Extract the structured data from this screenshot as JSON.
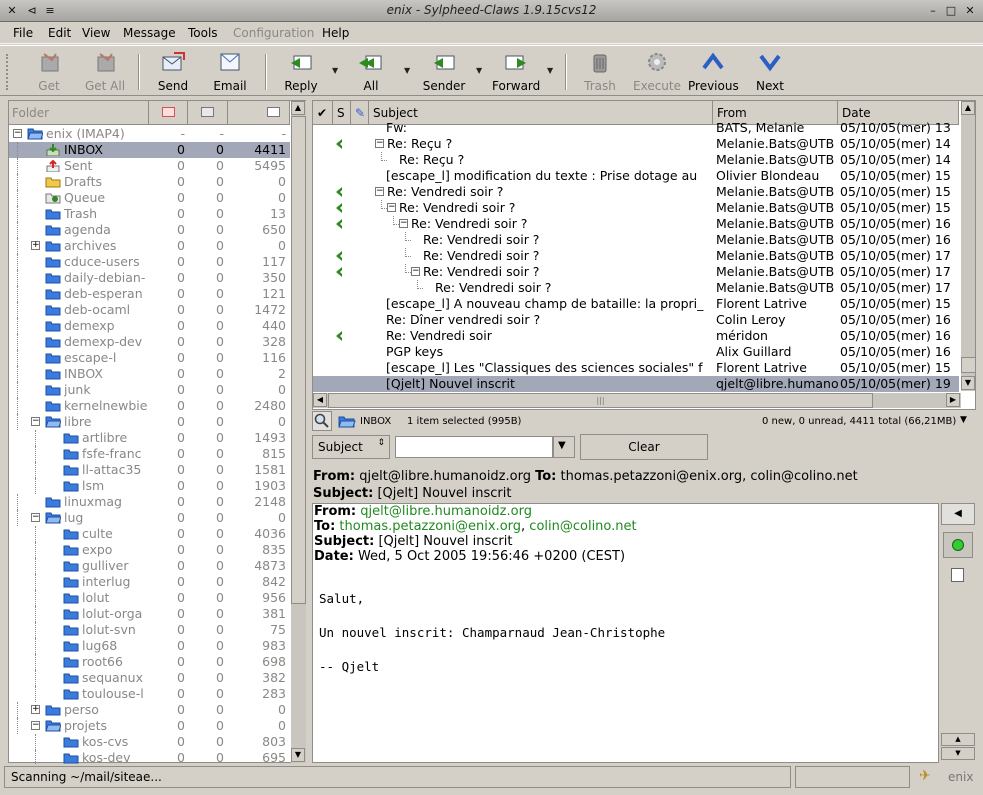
{
  "window": {
    "title": "enix - Sylpheed-Claws 1.9.15cvs12"
  },
  "menu": [
    {
      "label": "File",
      "disabled": false
    },
    {
      "label": "Edit",
      "disabled": false
    },
    {
      "label": "View",
      "disabled": false
    },
    {
      "label": "Message",
      "disabled": false
    },
    {
      "label": "Tools",
      "disabled": false
    },
    {
      "label": "Configuration",
      "disabled": true
    },
    {
      "label": "Help",
      "disabled": false
    }
  ],
  "toolbar": {
    "get": "Get",
    "get_all": "Get All",
    "send": "Send",
    "email": "Email",
    "reply": "Reply",
    "all": "All",
    "sender": "Sender",
    "forward": "Forward",
    "trash": "Trash",
    "execute": "Execute",
    "previous": "Previous",
    "next": "Next"
  },
  "folder_pane": {
    "header": "Folder",
    "folders": [
      {
        "name": "enix (IMAP4)",
        "new": "-",
        "unread": "-",
        "total": "-",
        "depth": 0,
        "icon": "folder-open-icon",
        "expander": "-"
      },
      {
        "name": "INBOX",
        "new": "0",
        "unread": "0",
        "total": "4411",
        "depth": 1,
        "icon": "inbox-icon",
        "selected": true
      },
      {
        "name": "Sent",
        "new": "0",
        "unread": "0",
        "total": "5495",
        "depth": 1,
        "icon": "outbox-icon"
      },
      {
        "name": "Drafts",
        "new": "0",
        "unread": "0",
        "total": "0",
        "depth": 1,
        "icon": "drafts-folder-icon"
      },
      {
        "name": "Queue",
        "new": "0",
        "unread": "0",
        "total": "0",
        "depth": 1,
        "icon": "queue-icon"
      },
      {
        "name": "Trash",
        "new": "0",
        "unread": "0",
        "total": "13",
        "depth": 1,
        "icon": "trash-icon"
      },
      {
        "name": "agenda",
        "new": "0",
        "unread": "0",
        "total": "650",
        "depth": 1,
        "icon": "folder-icon"
      },
      {
        "name": "archives",
        "new": "0",
        "unread": "0",
        "total": "0",
        "depth": 1,
        "icon": "folder-icon",
        "expander": "+"
      },
      {
        "name": "cduce-users",
        "new": "0",
        "unread": "0",
        "total": "117",
        "depth": 1,
        "icon": "folder-icon"
      },
      {
        "name": "daily-debian-",
        "new": "0",
        "unread": "0",
        "total": "350",
        "depth": 1,
        "icon": "folder-icon"
      },
      {
        "name": "deb-esperan",
        "new": "0",
        "unread": "0",
        "total": "121",
        "depth": 1,
        "icon": "folder-icon"
      },
      {
        "name": "deb-ocaml",
        "new": "0",
        "unread": "0",
        "total": "1472",
        "depth": 1,
        "icon": "folder-icon"
      },
      {
        "name": "demexp",
        "new": "0",
        "unread": "0",
        "total": "440",
        "depth": 1,
        "icon": "folder-icon"
      },
      {
        "name": "demexp-dev",
        "new": "0",
        "unread": "0",
        "total": "328",
        "depth": 1,
        "icon": "folder-icon"
      },
      {
        "name": "escape-l",
        "new": "0",
        "unread": "0",
        "total": "116",
        "depth": 1,
        "icon": "folder-icon"
      },
      {
        "name": "INBOX",
        "new": "0",
        "unread": "0",
        "total": "2",
        "depth": 1,
        "icon": "folder-icon"
      },
      {
        "name": "junk",
        "new": "0",
        "unread": "0",
        "total": "0",
        "depth": 1,
        "icon": "folder-icon"
      },
      {
        "name": "kernelnewbie",
        "new": "0",
        "unread": "0",
        "total": "2480",
        "depth": 1,
        "icon": "folder-icon"
      },
      {
        "name": "libre",
        "new": "0",
        "unread": "0",
        "total": "0",
        "depth": 1,
        "icon": "folder-open-icon",
        "expander": "-"
      },
      {
        "name": "artlibre",
        "new": "0",
        "unread": "0",
        "total": "1493",
        "depth": 2,
        "icon": "folder-icon"
      },
      {
        "name": "fsfe-franc",
        "new": "0",
        "unread": "0",
        "total": "815",
        "depth": 2,
        "icon": "folder-icon"
      },
      {
        "name": "ll-attac35",
        "new": "0",
        "unread": "0",
        "total": "1581",
        "depth": 2,
        "icon": "folder-icon"
      },
      {
        "name": "lsm",
        "new": "0",
        "unread": "0",
        "total": "1903",
        "depth": 2,
        "icon": "folder-icon"
      },
      {
        "name": "linuxmag",
        "new": "0",
        "unread": "0",
        "total": "2148",
        "depth": 1,
        "icon": "folder-icon"
      },
      {
        "name": "lug",
        "new": "0",
        "unread": "0",
        "total": "0",
        "depth": 1,
        "icon": "folder-open-icon",
        "expander": "-"
      },
      {
        "name": "culte",
        "new": "0",
        "unread": "0",
        "total": "4036",
        "depth": 2,
        "icon": "folder-icon"
      },
      {
        "name": "expo",
        "new": "0",
        "unread": "0",
        "total": "835",
        "depth": 2,
        "icon": "folder-icon"
      },
      {
        "name": "gulliver",
        "new": "0",
        "unread": "0",
        "total": "4873",
        "depth": 2,
        "icon": "folder-icon"
      },
      {
        "name": "interlug",
        "new": "0",
        "unread": "0",
        "total": "842",
        "depth": 2,
        "icon": "folder-icon"
      },
      {
        "name": "lolut",
        "new": "0",
        "unread": "0",
        "total": "956",
        "depth": 2,
        "icon": "folder-icon"
      },
      {
        "name": "lolut-orga",
        "new": "0",
        "unread": "0",
        "total": "381",
        "depth": 2,
        "icon": "folder-icon"
      },
      {
        "name": "lolut-svn",
        "new": "0",
        "unread": "0",
        "total": "75",
        "depth": 2,
        "icon": "folder-icon"
      },
      {
        "name": "lug68",
        "new": "0",
        "unread": "0",
        "total": "983",
        "depth": 2,
        "icon": "folder-icon"
      },
      {
        "name": "root66",
        "new": "0",
        "unread": "0",
        "total": "698",
        "depth": 2,
        "icon": "folder-icon"
      },
      {
        "name": "sequanux",
        "new": "0",
        "unread": "0",
        "total": "382",
        "depth": 2,
        "icon": "folder-icon"
      },
      {
        "name": "toulouse-l",
        "new": "0",
        "unread": "0",
        "total": "283",
        "depth": 2,
        "icon": "folder-icon"
      },
      {
        "name": "perso",
        "new": "0",
        "unread": "0",
        "total": "0",
        "depth": 1,
        "icon": "folder-icon",
        "expander": "+"
      },
      {
        "name": "projets",
        "new": "0",
        "unread": "0",
        "total": "0",
        "depth": 1,
        "icon": "folder-open-icon",
        "expander": "-"
      },
      {
        "name": "kos-cvs",
        "new": "0",
        "unread": "0",
        "total": "803",
        "depth": 2,
        "icon": "folder-icon"
      },
      {
        "name": "kos-dev",
        "new": "0",
        "unread": "0",
        "total": "695",
        "depth": 2,
        "icon": "folder-icon"
      }
    ]
  },
  "message_list": {
    "columns": {
      "subject": "Subject",
      "from": "From",
      "date": "Date"
    },
    "rows": [
      {
        "subject": "Fw:",
        "from": "BATS, Melanie",
        "date": "05/10/05(mer) 13",
        "indent": 0,
        "replied": false
      },
      {
        "subject": "Re: Reçu ?",
        "from": "Melanie.Bats@UTB",
        "date": "05/10/05(mer) 14",
        "indent": 0,
        "replied": true,
        "expander": "-"
      },
      {
        "subject": "Re: Reçu ?",
        "from": "Melanie.Bats@UTB",
        "date": "05/10/05(mer) 14",
        "indent": 1,
        "replied": false
      },
      {
        "subject": "[escape_l] modification du texte : Prise dotage au",
        "from": "Olivier Blondeau",
        "date": "05/10/05(mer) 15",
        "indent": 0,
        "replied": false
      },
      {
        "subject": "Re: Vendredi soir ?",
        "from": "Melanie.Bats@UTB",
        "date": "05/10/05(mer) 15",
        "indent": 0,
        "replied": true,
        "expander": "-"
      },
      {
        "subject": "Re: Vendredi soir ?",
        "from": "Melanie.Bats@UTB",
        "date": "05/10/05(mer) 15",
        "indent": 1,
        "replied": true,
        "expander": "-"
      },
      {
        "subject": "Re: Vendredi soir ?",
        "from": "Melanie.Bats@UTB",
        "date": "05/10/05(mer) 16",
        "indent": 2,
        "replied": true,
        "expander": "-"
      },
      {
        "subject": "Re: Vendredi soir ?",
        "from": "Melanie.Bats@UTB",
        "date": "05/10/05(mer) 16",
        "indent": 3,
        "replied": false
      },
      {
        "subject": "Re: Vendredi soir ?",
        "from": "Melanie.Bats@UTB",
        "date": "05/10/05(mer) 17",
        "indent": 3,
        "replied": true
      },
      {
        "subject": "Re: Vendredi soir ?",
        "from": "Melanie.Bats@UTB",
        "date": "05/10/05(mer) 17",
        "indent": 3,
        "replied": true,
        "expander": "-"
      },
      {
        "subject": "Re: Vendredi soir ?",
        "from": "Melanie.Bats@UTB",
        "date": "05/10/05(mer) 17",
        "indent": 4,
        "replied": false
      },
      {
        "subject": "[escape_l] A nouveau champ de bataille: la propri_",
        "from": "Florent Latrive",
        "date": "05/10/05(mer) 15",
        "indent": 0,
        "replied": false
      },
      {
        "subject": "Re: Dîner vendredi soir ?",
        "from": "Colin Leroy",
        "date": "05/10/05(mer) 16",
        "indent": 0,
        "replied": false
      },
      {
        "subject": "Re: Vendredi soir",
        "from": "méridon",
        "date": "05/10/05(mer) 16",
        "indent": 0,
        "replied": true
      },
      {
        "subject": "PGP keys",
        "from": "Alix Guillard",
        "date": "05/10/05(mer) 16",
        "indent": 0,
        "replied": false
      },
      {
        "subject": "[escape_l] Les \"Classiques des sciences sociales\" f",
        "from": "Florent Latrive",
        "date": "05/10/05(mer) 15",
        "indent": 0,
        "replied": false
      },
      {
        "subject": "[Qjelt] Nouvel inscrit",
        "from": "qjelt@libre.humanoidz.org",
        "date": "05/10/05(mer) 19",
        "indent": 0,
        "replied": false,
        "selected": true
      }
    ]
  },
  "info_bar": {
    "folder": "INBOX",
    "selection": "1 item selected (995B)",
    "counts": "0 new, 0 unread, 4411 total (66,21MB)"
  },
  "search": {
    "field": "Subject",
    "value": "",
    "clear": "Clear"
  },
  "summary_header": {
    "from_label": "From:",
    "from": "qjelt@libre.humanoidz.org",
    "to_label": "To:",
    "to": "thomas.petazzoni@enix.org, colin@colino.net",
    "subject_label": "Subject:",
    "subject": "[Qjelt] Nouvel inscrit"
  },
  "message": {
    "from_label": "From:",
    "from": "qjelt@libre.humanoidz.org",
    "to_label": "To:",
    "to_1": "thomas.petazzoni@enix.org",
    "to_sep": ",",
    "to_2": "colin@colino.net",
    "subject_label": "Subject:",
    "subject": "[Qjelt] Nouvel inscrit",
    "date_label": "Date:",
    "date": "Wed,  5 Oct 2005 19:56:46 +0200 (CEST)",
    "body_1": "Salut,",
    "body_2": "Un nouvel inscrit: Champarnaud Jean-Christophe",
    "body_3": "-- Qjelt"
  },
  "statusbar": {
    "text": "Scanning ~/mail/siteae...",
    "account": "enix"
  },
  "colors": {
    "selection": "#a3a8b8",
    "link": "#208a20",
    "folder_blue": "#3a7be0",
    "reply_green": "#2e8b22"
  }
}
